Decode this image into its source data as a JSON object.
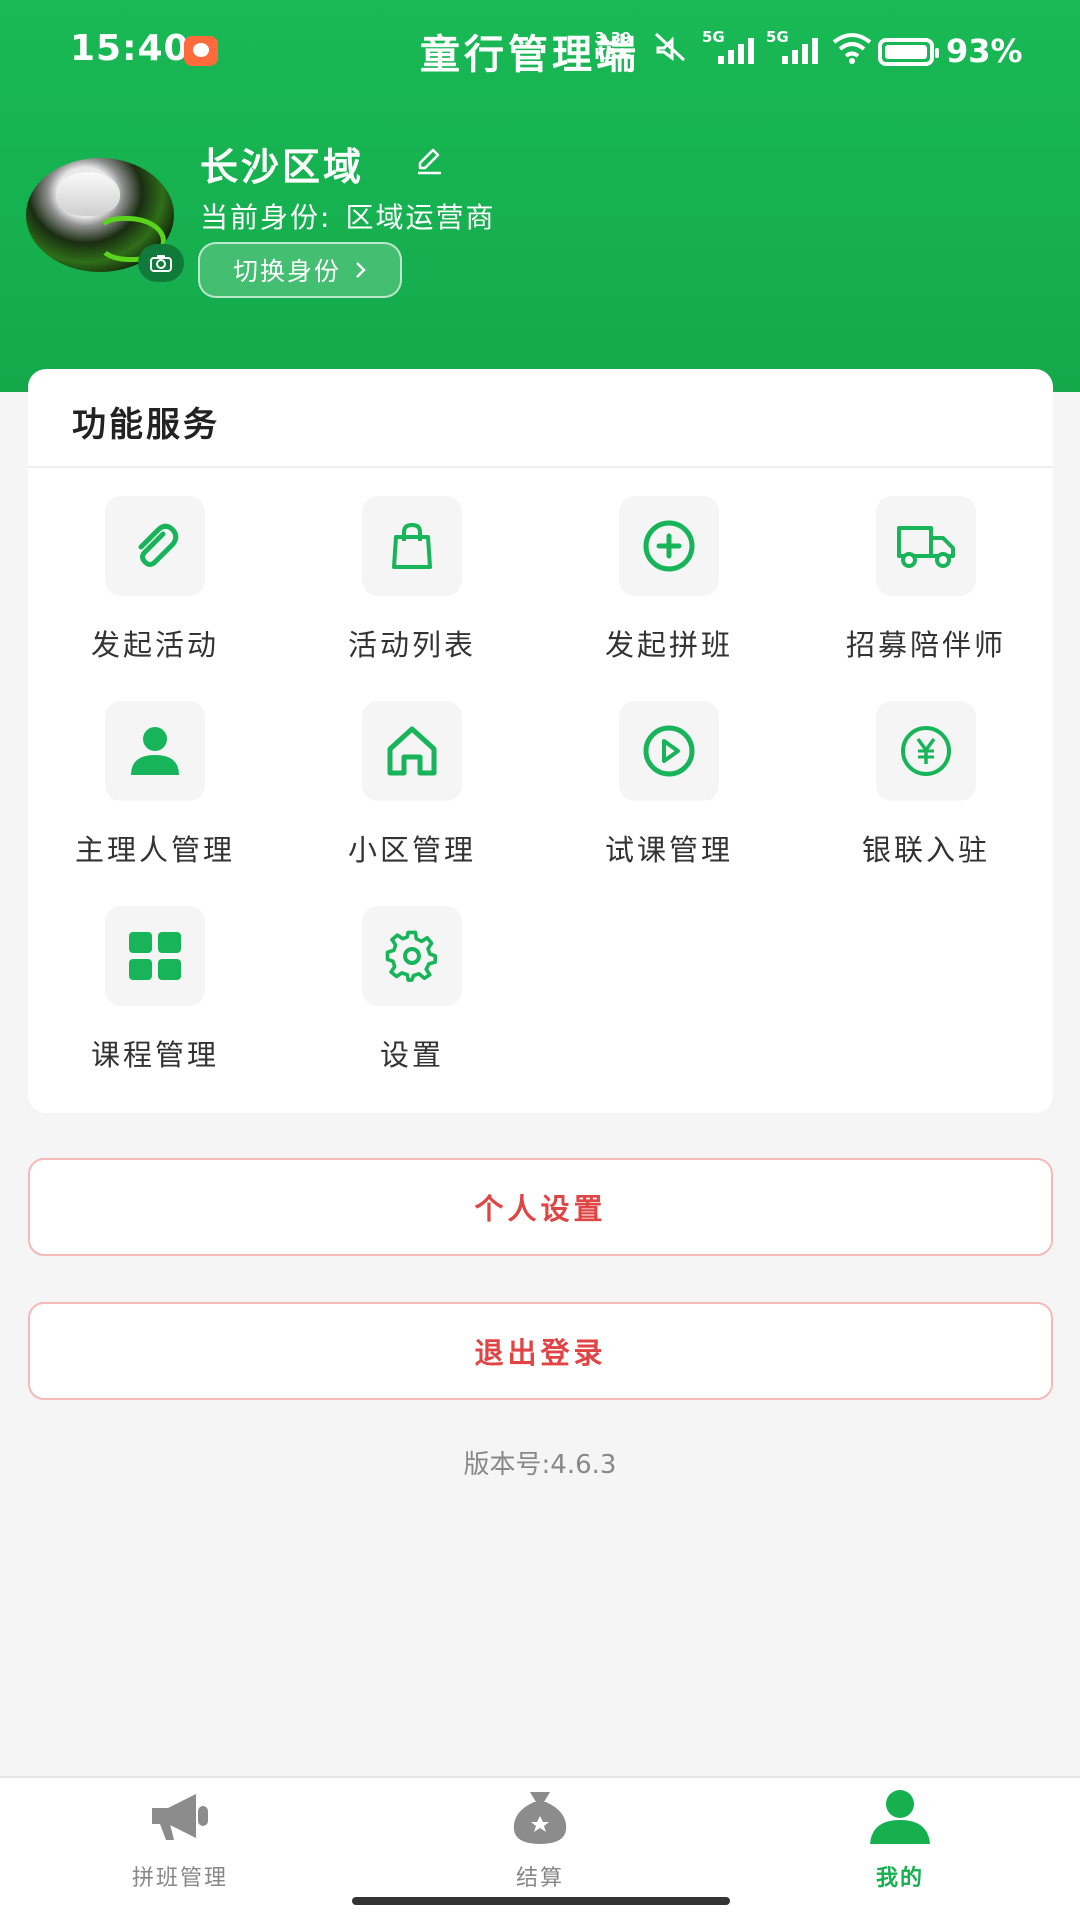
{
  "status_bar": {
    "time": "15:40",
    "app_title": "童行管理端",
    "net_speed": "3.39 KB/s",
    "sim1": "5G",
    "sim2": "5G",
    "battery": "93%"
  },
  "profile": {
    "name": "长沙区域",
    "role_label": "当前身份:",
    "role_value": "区域运营商",
    "switch_label": "切换身份"
  },
  "services": {
    "title": "功能服务",
    "items": [
      {
        "label": "发起活动",
        "icon": "paperclip-icon"
      },
      {
        "label": "活动列表",
        "icon": "shopping-bag-icon"
      },
      {
        "label": "发起拼班",
        "icon": "plus-circle-icon"
      },
      {
        "label": "招募陪伴师",
        "icon": "truck-icon"
      },
      {
        "label": "主理人管理",
        "icon": "person-icon"
      },
      {
        "label": "小区管理",
        "icon": "home-icon"
      },
      {
        "label": "试课管理",
        "icon": "play-circle-icon"
      },
      {
        "label": "银联入驻",
        "icon": "yen-circle-icon"
      },
      {
        "label": "课程管理",
        "icon": "grid-icon"
      },
      {
        "label": "设置",
        "icon": "gear-icon"
      }
    ]
  },
  "buttons": {
    "personal_settings": "个人设置",
    "logout": "退出登录"
  },
  "version": "版本号:4.6.3",
  "tabbar": {
    "tabs": [
      {
        "label": "拼班管理",
        "icon": "megaphone-icon",
        "active": false
      },
      {
        "label": "结算",
        "icon": "money-bag-icon",
        "active": false
      },
      {
        "label": "我的",
        "icon": "user-icon",
        "active": true
      }
    ]
  },
  "colors": {
    "brand_green": "#16b04f",
    "danger_red": "#e04545"
  }
}
